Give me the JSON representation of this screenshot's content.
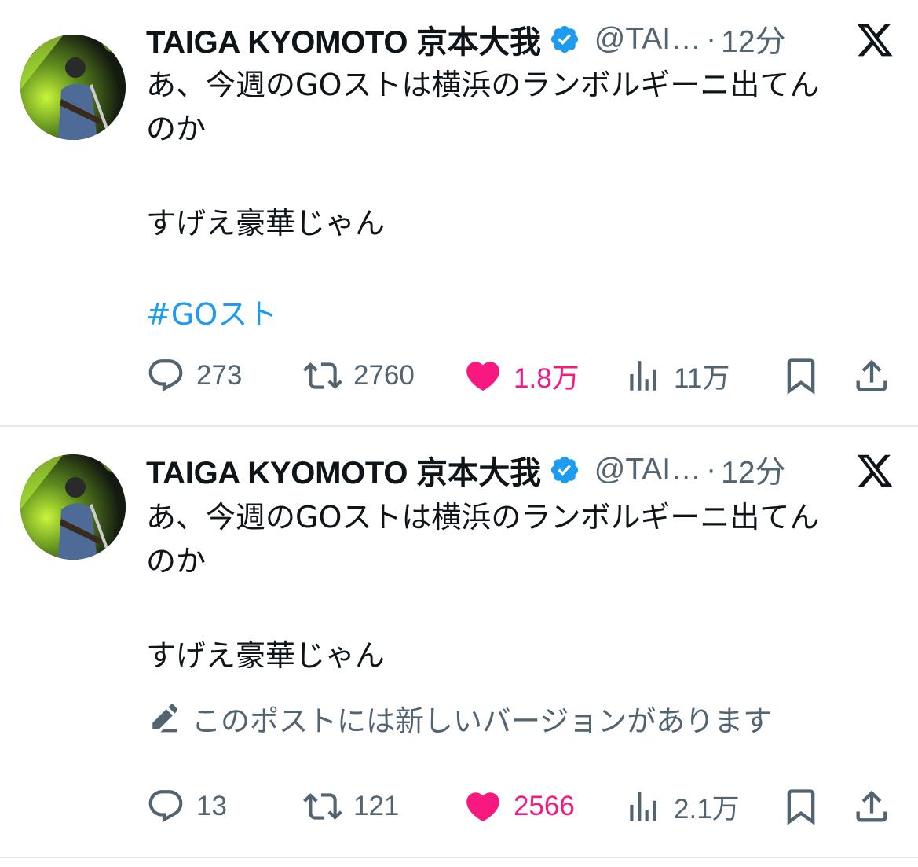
{
  "colors": {
    "text": "#0f1419",
    "secondary": "#536471",
    "link": "#1d9bf0",
    "like": "#f91880",
    "verified": "#1d9bf0",
    "divider": "#e6e9ec"
  },
  "tweets": [
    {
      "display_name": "TAIGA KYOMOTO 京本大我",
      "handle": "@TAI…",
      "separator": "·",
      "time": "12分",
      "body_lines": [
        "あ、今週のGOストは横浜のランボルギーニ出てん",
        "のか",
        "すげえ豪華じゃん"
      ],
      "hashtag": "#GOスト",
      "stats": {
        "replies": "273",
        "reposts": "2760",
        "likes": "1.8万",
        "views": "11万"
      },
      "icons": [
        "verified-badge-icon",
        "x-logo-icon",
        "reply-icon",
        "repost-icon",
        "heart-icon",
        "views-icon",
        "bookmark-icon",
        "share-icon"
      ]
    },
    {
      "display_name": "TAIGA KYOMOTO 京本大我",
      "handle": "@TAI…",
      "separator": "·",
      "time": "12分",
      "body_lines": [
        "あ、今週のGOストは横浜のランボルギーニ出てん",
        "のか",
        "すげえ豪華じゃん"
      ],
      "edit_notice": "このポストには新しいバージョンがあります",
      "stats": {
        "replies": "13",
        "reposts": "121",
        "likes": "2566",
        "views": "2.1万"
      },
      "icons": [
        "verified-badge-icon",
        "x-logo-icon",
        "edit-pencil-icon",
        "reply-icon",
        "repost-icon",
        "heart-icon",
        "views-icon",
        "bookmark-icon",
        "share-icon"
      ]
    }
  ]
}
